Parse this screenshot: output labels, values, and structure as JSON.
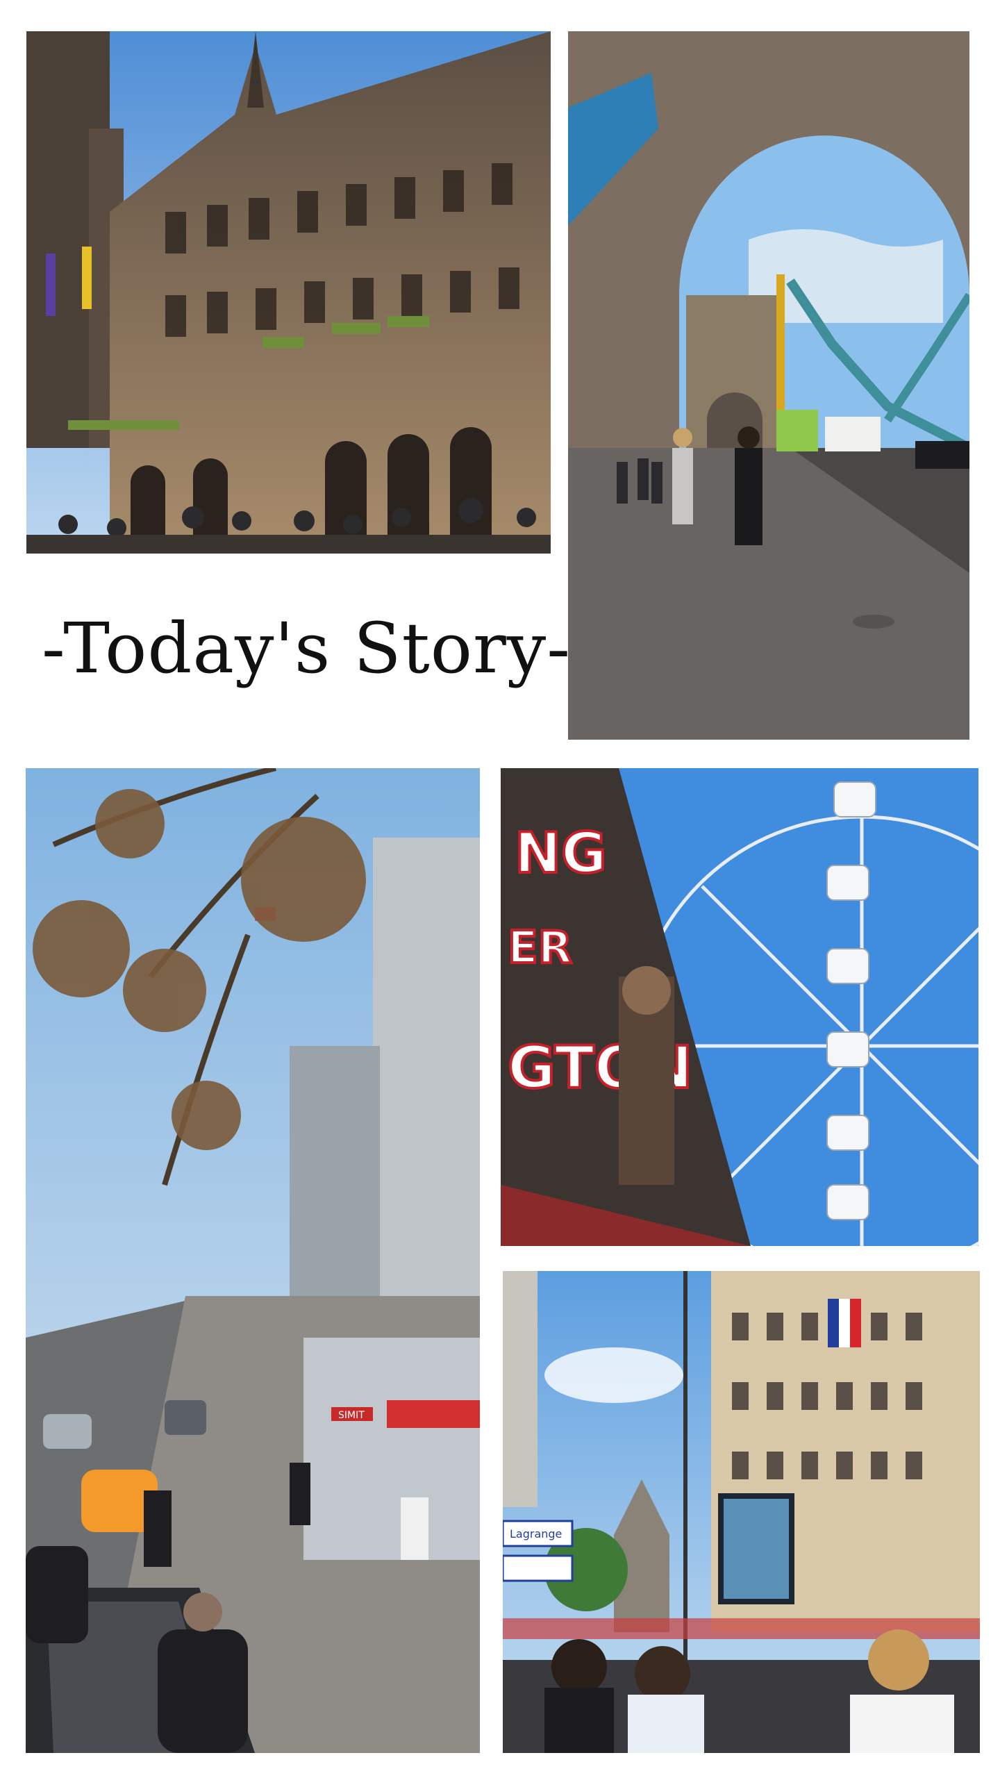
{
  "story": {
    "title": "-Today's Story-"
  },
  "panels": {
    "p4_sign_top": "NG",
    "p4_sign_mid": "ER",
    "p4_sign_bottom": "GTON",
    "p3_sign": "SIMIT",
    "p5_sign": "Lagrange"
  },
  "colors": {
    "sky": "#7ab6e8",
    "stone": "#8a7a66",
    "red_sign": "#c8202a",
    "taxi": "#f39a2a",
    "tricolor_blue": "#1f3f9a",
    "tricolor_red": "#d7262b"
  }
}
